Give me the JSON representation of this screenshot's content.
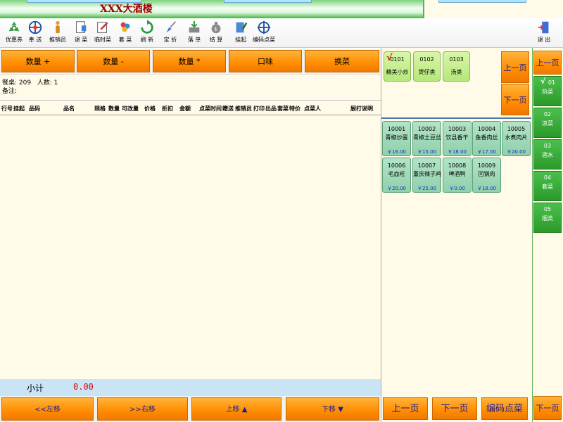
{
  "window": {
    "title": "XXX大酒楼"
  },
  "toolbar": {
    "items": [
      {
        "label": "优惠券",
        "icon": "recycle-icon"
      },
      {
        "label": "奉 送",
        "icon": "gift-icon"
      },
      {
        "label": "推销员",
        "icon": "person-icon"
      },
      {
        "label": "退 菜",
        "icon": "document-icon"
      },
      {
        "label": "临时菜",
        "icon": "edit-document-icon"
      },
      {
        "label": "套 菜",
        "icon": "balloons-icon"
      },
      {
        "label": "刷 新",
        "icon": "refresh-icon"
      },
      {
        "label": "定 折",
        "icon": "brush-icon"
      },
      {
        "label": "落 单",
        "icon": "print-icon"
      },
      {
        "label": "结 算",
        "icon": "money-bag-icon"
      },
      {
        "label": "挂起",
        "icon": "pencil-icon"
      },
      {
        "label": "编码点菜",
        "icon": "crosshair-icon"
      }
    ],
    "exit_label": "退 出"
  },
  "actions": {
    "qty_plus": "数量 +",
    "qty_minus": "数量 -",
    "qty_multiply": "数量 *",
    "flavor": "口味",
    "replace": "换菜"
  },
  "order_info": {
    "table_label": "餐桌:",
    "table_value": "209",
    "guests_label": "人数:",
    "guests_value": "1",
    "remark_label": "备注:"
  },
  "order_table": {
    "columns": [
      "行号",
      "挂起",
      "品码",
      "品名",
      "规格",
      "数量",
      "可改量",
      "价格",
      "折扣",
      "金额",
      "点菜时间",
      "赠送",
      "推销员",
      "打印",
      "出品",
      "套菜",
      "特价",
      "点菜人",
      "厨打说明"
    ]
  },
  "subtotal": {
    "label": "小计",
    "value": "0.00"
  },
  "bottom_nav": {
    "left": "<<左移",
    "right": ">>右移",
    "up": "上移 ▲",
    "down": "下移 ▼"
  },
  "categories": [
    {
      "code": "0101",
      "name": "精美小炒",
      "selected": true
    },
    {
      "code": "0102",
      "name": "煲仔类",
      "selected": false
    },
    {
      "code": "0103",
      "name": "汤类",
      "selected": false
    }
  ],
  "category_nav": {
    "prev": "上一页",
    "next": "下一页"
  },
  "dishes": [
    {
      "code": "10001",
      "name": "青椒炒蛋",
      "price": "￥16.00"
    },
    {
      "code": "10002",
      "name": "青椒土豆丝",
      "price": "￥15.00"
    },
    {
      "code": "10003",
      "name": "饮县香干",
      "price": "￥18.00"
    },
    {
      "code": "10004",
      "name": "鱼香肉丝",
      "price": "￥17.00"
    },
    {
      "code": "10005",
      "name": "水煮肉片",
      "price": "￥20.00"
    },
    {
      "code": "10006",
      "name": "毛血旺",
      "price": "￥20.00"
    },
    {
      "code": "10007",
      "name": "重庆辣子鸡",
      "price": "￥25.00"
    },
    {
      "code": "10008",
      "name": "啤酒鸭",
      "price": "￥0.00"
    },
    {
      "code": "10009",
      "name": "回锅肉",
      "price": "￥18.00"
    }
  ],
  "dish_nav": {
    "prev": "上一页",
    "next": "下一页",
    "code_order": "编码点菜"
  },
  "side_categories": [
    {
      "code": "01",
      "name": "热菜",
      "selected": true
    },
    {
      "code": "02",
      "name": "凉菜",
      "selected": false
    },
    {
      "code": "03",
      "name": "酒水",
      "selected": false
    },
    {
      "code": "04",
      "name": "套菜",
      "selected": false
    },
    {
      "code": "05",
      "name": "烟类",
      "selected": false
    }
  ],
  "side_nav": {
    "prev": "上一页",
    "next": "下一页"
  }
}
